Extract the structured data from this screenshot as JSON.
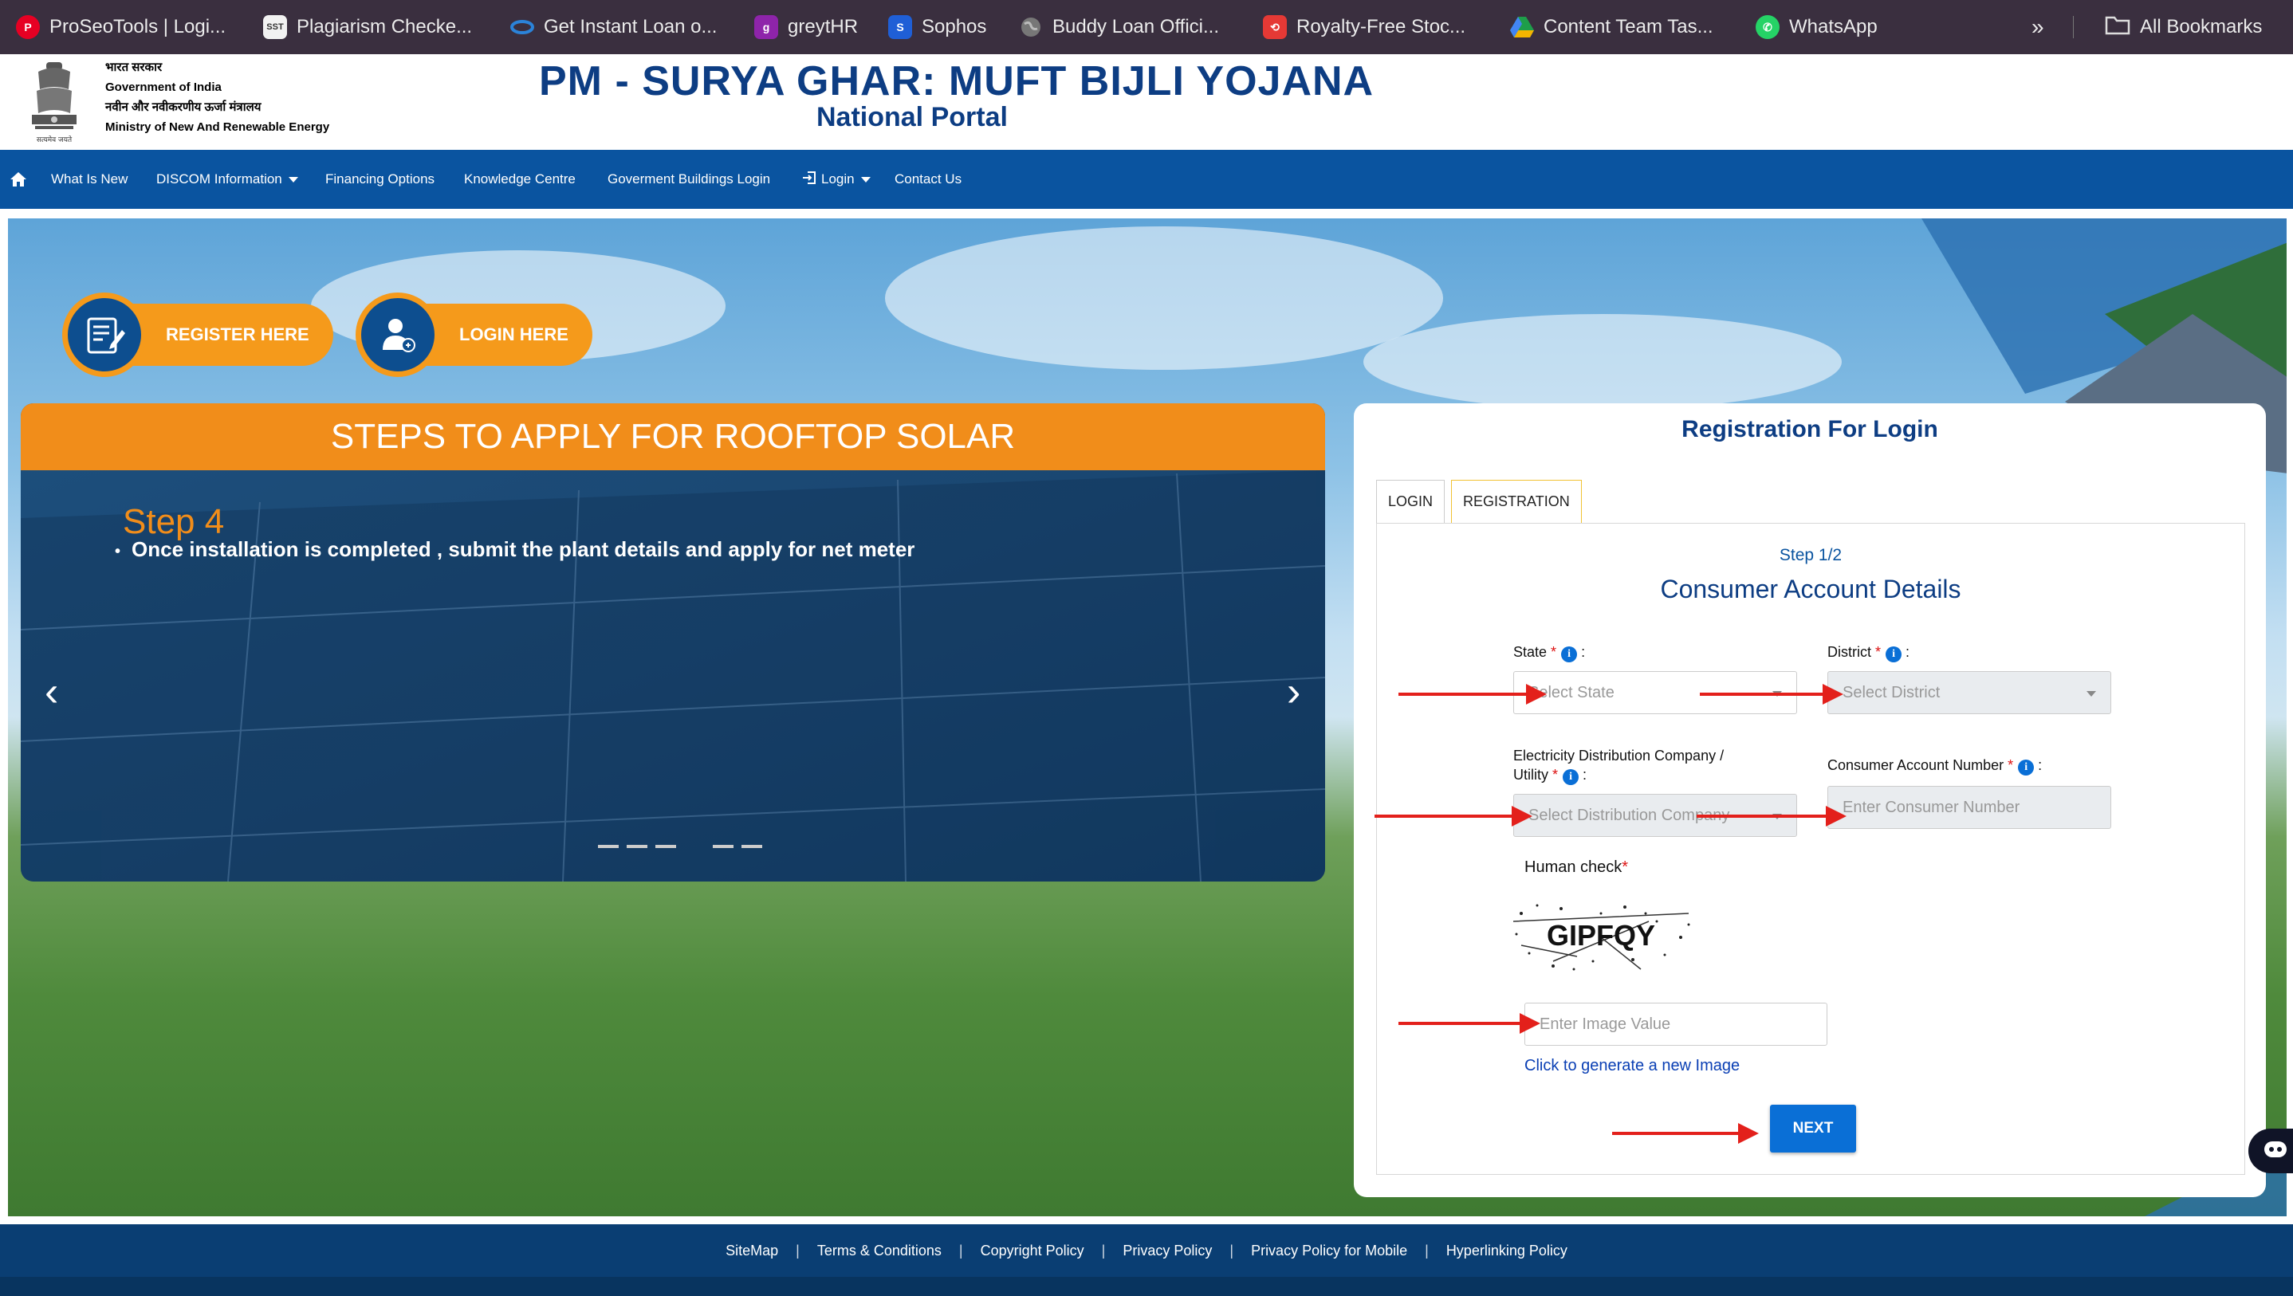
{
  "bookmarks": [
    {
      "label": "ProSeoTools | Logi...",
      "icon": "pinterest-icon",
      "color": "#e60023"
    },
    {
      "label": "Plagiarism Checke...",
      "icon": "sst-icon",
      "color": "#6b6b6b"
    },
    {
      "label": "Get Instant Loan o...",
      "icon": "loan-icon",
      "color": "#2b83d9"
    },
    {
      "label": "greytHR",
      "icon": "greythr-icon",
      "color": "#8e24aa"
    },
    {
      "label": "Sophos",
      "icon": "sophos-icon",
      "color": "#1f5fd6"
    },
    {
      "label": "Buddy Loan Offici...",
      "icon": "globe-icon",
      "color": "#888888"
    },
    {
      "label": "Royalty-Free Stoc...",
      "icon": "stock-icon",
      "color": "#e53935"
    },
    {
      "label": "Content Team Tas...",
      "icon": "drive-icon",
      "color": "#1e9e4a"
    },
    {
      "label": "WhatsApp",
      "icon": "whatsapp-icon",
      "color": "#25d366"
    }
  ],
  "all_bookmarks": "All Bookmarks",
  "header": {
    "gov_lines": [
      "भारत सरकार",
      "Government of India",
      "नवीन और नवीकरणीय ऊर्जा मंत्रालय",
      "Ministry of New And Renewable Energy"
    ],
    "emblem_caption": "सत्यमेव जयते",
    "title": "PM - SURYA GHAR: MUFT BIJLI YOJANA",
    "subtitle": "National Portal"
  },
  "nav": {
    "items": [
      "What Is New",
      "DISCOM Information",
      "Financing Options",
      "Knowledge Centre",
      "Goverment Buildings Login",
      "Login",
      "Contact Us"
    ]
  },
  "hero": {
    "register_label": "REGISTER HERE",
    "login_label": "LOGIN HERE"
  },
  "steps": {
    "heading": "STEPS TO APPLY FOR ROOFTOP SOLAR",
    "step_title": "Step 4",
    "step_text": "Once installation is completed , submit the plant details and apply for net meter"
  },
  "form": {
    "title": "Registration For Login",
    "tabs": [
      "LOGIN",
      "REGISTRATION"
    ],
    "step": "Step 1/2",
    "section_title": "Consumer Account Details",
    "state_label": "State",
    "state_placeholder": "Select State",
    "district_label": "District",
    "district_placeholder": "Select District",
    "discom_label_1": "Electricity Distribution Company /",
    "discom_label_2": "Utility",
    "discom_placeholder": "Select Distribution Company",
    "consumer_label": "Consumer Account Number",
    "consumer_placeholder": "Enter Consumer Number",
    "human_check": "Human check",
    "captcha": "GIPFQY",
    "image_placeholder": "Enter Image Value",
    "regen_link": "Click to generate a new Image",
    "next": "NEXT"
  },
  "footer": {
    "links": [
      "SiteMap",
      "Terms & Conditions",
      "Copyright Policy",
      "Privacy Policy",
      "Privacy Policy for Mobile",
      "Hyperlinking Policy"
    ]
  },
  "colors": {
    "brand_blue": "#0d3d83",
    "nav_blue": "#0a54a0",
    "accent_orange": "#f18d1a",
    "button_blue": "#0a6fd6",
    "annotation_red": "#e3201b"
  }
}
